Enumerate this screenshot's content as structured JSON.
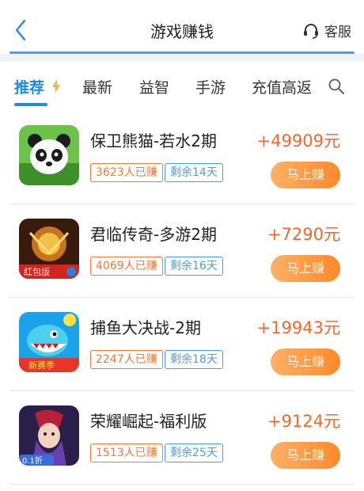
{
  "header": {
    "title": "游戏赚钱",
    "service_label": "客服"
  },
  "tabs": [
    {
      "label": "推荐"
    },
    {
      "label": "最新"
    },
    {
      "label": "益智"
    },
    {
      "label": "手游"
    },
    {
      "label": "充值高返"
    }
  ],
  "games": [
    {
      "name": "保卫熊猫-若水2期",
      "earned": "3623人已赚",
      "remaining": "剩余14天",
      "reward": "+49909元",
      "button": "马上赚"
    },
    {
      "name": "君临传奇-多游2期",
      "earned": "4069人已赚",
      "remaining": "剩余16天",
      "reward": "+7290元",
      "button": "马上赚",
      "badge": "红包版"
    },
    {
      "name": "捕鱼大决战-2期",
      "earned": "2247人已赚",
      "remaining": "剩余18天",
      "reward": "+19943元",
      "button": "马上赚",
      "badge": "新赛季"
    },
    {
      "name": "荣耀崛起-福利版",
      "earned": "1513人已赚",
      "remaining": "剩余25天",
      "reward": "+9124元",
      "button": "马上赚",
      "badge": "0.1折"
    }
  ],
  "colors": {
    "accent_blue": "#1e8bea",
    "reward_orange": "#f06a2e",
    "button_orange": "#ff8a2a"
  },
  "icons": [
    "back-arrow-icon",
    "headset-icon",
    "lightning-icon",
    "search-icon"
  ]
}
